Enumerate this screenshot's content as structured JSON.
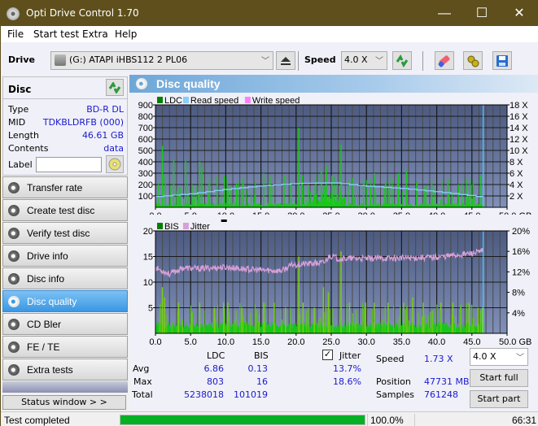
{
  "window": {
    "title": "Opti Drive Control 1.70",
    "minimize": "—",
    "maximize": "☐",
    "close": "✕"
  },
  "menu": [
    "File",
    "Start test",
    "Extra",
    "Help"
  ],
  "toolbar": {
    "drive_label": "Drive",
    "drive_value": "(G:)  ATAPI iHBS112   2 PL06",
    "speed_label": "Speed",
    "speed_value": "4.0 X",
    "icons": [
      "eject-icon",
      "refresh-icon",
      "erase-icon",
      "settings-icon",
      "save-icon"
    ]
  },
  "disc": {
    "header": "Disc",
    "rows": [
      {
        "key": "Type",
        "value": "BD-R DL"
      },
      {
        "key": "MID",
        "value": "TDKBLDRFB (000)"
      },
      {
        "key": "Length",
        "value": "46.61 GB"
      },
      {
        "key": "Contents",
        "value": "data"
      }
    ],
    "label_key": "Label",
    "label_value": ""
  },
  "nav": [
    {
      "label": "Transfer rate",
      "active": false
    },
    {
      "label": "Create test disc",
      "active": false
    },
    {
      "label": "Verify test disc",
      "active": false
    },
    {
      "label": "Drive info",
      "active": false
    },
    {
      "label": "Disc info",
      "active": false
    },
    {
      "label": "Disc quality",
      "active": true
    },
    {
      "label": "CD Bler",
      "active": false
    },
    {
      "label": "FE / TE",
      "active": false
    },
    {
      "label": "Extra tests",
      "active": false
    }
  ],
  "status_window_button": "Status window > >",
  "panel_title": "Disc quality",
  "chart_data": [
    {
      "type": "bar",
      "title": "LDC",
      "legend": [
        {
          "name": "LDC",
          "color": "#008000"
        },
        {
          "name": "Read speed",
          "color": "#87cefa"
        },
        {
          "name": "Write speed",
          "color": "#ff80ff"
        }
      ],
      "xlabel": "GB",
      "xlim": [
        0,
        50
      ],
      "x_ticks": [
        "0.0",
        "5.0",
        "10.0",
        "15.0",
        "20.0",
        "25.0",
        "30.0",
        "35.0",
        "40.0",
        "45.0",
        "50.0 GB"
      ],
      "ylim_left": [
        0,
        900
      ],
      "y_ticks_left": [
        "100",
        "200",
        "300",
        "400",
        "500",
        "600",
        "700",
        "800",
        "900"
      ],
      "ylim_right": [
        0,
        18
      ],
      "y_ticks_right": [
        "2 X",
        "4 X",
        "6 X",
        "8 X",
        "10 X",
        "12 X",
        "14 X",
        "16 X",
        "18 X"
      ],
      "grid": true,
      "end_marker_gb": 46.61,
      "ldc_spikes": [
        [
          0.9,
          540
        ],
        [
          1.3,
          290
        ],
        [
          2.5,
          420
        ],
        [
          3.3,
          180
        ],
        [
          4.2,
          410
        ],
        [
          5.1,
          200
        ],
        [
          6.2,
          400
        ],
        [
          6.5,
          350
        ],
        [
          7.6,
          260
        ],
        [
          8.7,
          270
        ],
        [
          9.7,
          280
        ],
        [
          10.1,
          270
        ],
        [
          11.5,
          200
        ],
        [
          12.4,
          260
        ],
        [
          14.1,
          220
        ],
        [
          15.3,
          300
        ],
        [
          16.2,
          270
        ],
        [
          18.2,
          280
        ],
        [
          19.2,
          220
        ],
        [
          20.3,
          700
        ],
        [
          20.8,
          280
        ],
        [
          22.7,
          290
        ],
        [
          23.5,
          320
        ],
        [
          24.2,
          360
        ],
        [
          25.0,
          280
        ],
        [
          26.3,
          550
        ],
        [
          28.0,
          260
        ],
        [
          29.5,
          240
        ],
        [
          31.0,
          300
        ],
        [
          33.2,
          270
        ],
        [
          34.5,
          300
        ],
        [
          35.6,
          320
        ],
        [
          37.1,
          230
        ],
        [
          39.2,
          230
        ],
        [
          41.5,
          250
        ],
        [
          43.0,
          200
        ],
        [
          45.1,
          230
        ],
        [
          46.2,
          280
        ]
      ],
      "read_speed": [
        [
          0,
          1.9
        ],
        [
          5,
          2.4
        ],
        [
          10,
          3.2
        ],
        [
          15,
          3.8
        ],
        [
          20,
          4.2
        ],
        [
          25,
          4.3
        ],
        [
          30,
          3.7
        ],
        [
          35,
          3.3
        ],
        [
          40,
          2.7
        ],
        [
          45,
          2.0
        ],
        [
          46.61,
          1.73
        ]
      ]
    },
    {
      "type": "bar",
      "title": "BIS / Jitter",
      "legend": [
        {
          "name": "BIS",
          "color": "#008000"
        },
        {
          "name": "Jitter",
          "color": "#d8a0d8"
        }
      ],
      "xlabel": "GB",
      "xlim": [
        0,
        50
      ],
      "x_ticks": [
        "0.0",
        "5.0",
        "10.0",
        "15.0",
        "20.0",
        "25.0",
        "30.0",
        "35.0",
        "40.0",
        "45.0",
        "50.0 GB"
      ],
      "ylim_left": [
        0,
        20
      ],
      "y_ticks_left": [
        "5",
        "10",
        "15",
        "20"
      ],
      "ylim_right": [
        0,
        20
      ],
      "y_ticks_right": [
        "4%",
        "8%",
        "12%",
        "16%",
        "20%"
      ],
      "grid": true,
      "end_marker_gb": 46.61,
      "bis_spikes": [
        [
          0.9,
          9
        ],
        [
          1.2,
          7
        ],
        [
          3.2,
          6
        ],
        [
          5.0,
          4
        ],
        [
          6.2,
          6
        ],
        [
          8.3,
          5
        ],
        [
          9.6,
          6
        ],
        [
          10.2,
          6
        ],
        [
          12.2,
          5
        ],
        [
          15.3,
          6
        ],
        [
          16.8,
          6
        ],
        [
          18.4,
          5
        ],
        [
          20.3,
          15
        ],
        [
          20.9,
          6
        ],
        [
          22.5,
          5
        ],
        [
          23.8,
          9
        ],
        [
          24.5,
          8
        ],
        [
          26.3,
          16
        ],
        [
          27.5,
          6
        ],
        [
          29.8,
          6
        ],
        [
          31.0,
          6
        ],
        [
          33.0,
          6
        ],
        [
          35.2,
          6
        ],
        [
          36.5,
          7
        ],
        [
          38.0,
          6
        ],
        [
          40.5,
          6
        ],
        [
          42.2,
          6
        ],
        [
          44.5,
          6
        ],
        [
          45.8,
          5
        ],
        [
          46.4,
          5
        ]
      ],
      "jitter_pct": [
        [
          0,
          12.8
        ],
        [
          2,
          11.6
        ],
        [
          4,
          12.8
        ],
        [
          6,
          12.6
        ],
        [
          8,
          12.8
        ],
        [
          10,
          12.9
        ],
        [
          14,
          12.4
        ],
        [
          18,
          12.2
        ],
        [
          19.5,
          13.4
        ],
        [
          22,
          13.6
        ],
        [
          24,
          13.8
        ],
        [
          24.8,
          15.2
        ],
        [
          26,
          14.6
        ],
        [
          30,
          14.6
        ],
        [
          35,
          14.7
        ],
        [
          40,
          14.9
        ],
        [
          43,
          15.3
        ],
        [
          46,
          15.8
        ],
        [
          46.61,
          16.1
        ]
      ]
    }
  ],
  "stats": {
    "col_ldc": "LDC",
    "col_bis": "BIS",
    "jitter_label": "Jitter",
    "jitter_checked": true,
    "rows": [
      {
        "label": "Avg",
        "ldc": "6.86",
        "bis": "0.13",
        "jitter": "13.7%"
      },
      {
        "label": "Max",
        "ldc": "803",
        "bis": "16",
        "jitter": "18.6%"
      },
      {
        "label": "Total",
        "ldc": "5238018",
        "bis": "101019",
        "jitter": ""
      }
    ],
    "speed_label": "Speed",
    "speed_value": "1.73 X",
    "position_label": "Position",
    "position_value": "47731 MB",
    "samples_label": "Samples",
    "samples_value": "761248",
    "speed_select": "4.0 X",
    "start_full": "Start full",
    "start_part": "Start part"
  },
  "statusbar": {
    "text": "Test completed",
    "progress_pct": 100,
    "progress_text": "100.0%",
    "time": "66:31"
  }
}
